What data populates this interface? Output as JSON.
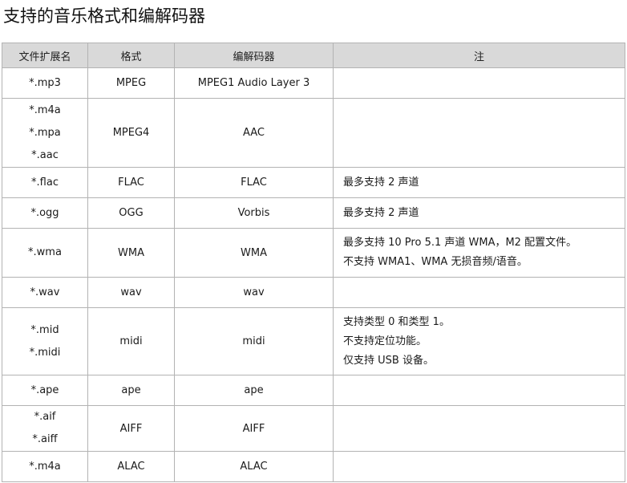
{
  "title": "支持的音乐格式和编解码器",
  "headers": [
    "文件扩展名",
    "格式",
    "编解码器",
    "注"
  ],
  "rows": [
    {
      "ext": [
        "*.mp3"
      ],
      "format": "MPEG",
      "codec": "MPEG1 Audio Layer 3",
      "notes": []
    },
    {
      "ext": [
        "*.m4a",
        "*.mpa",
        "*.aac"
      ],
      "format": "MPEG4",
      "codec": "AAC",
      "notes": []
    },
    {
      "ext": [
        "*.flac"
      ],
      "format": "FLAC",
      "codec": "FLAC",
      "notes": [
        "最多支持 2 声道"
      ]
    },
    {
      "ext": [
        "*.ogg"
      ],
      "format": "OGG",
      "codec": "Vorbis",
      "notes": [
        "最多支持 2 声道"
      ]
    },
    {
      "ext": [
        "*.wma"
      ],
      "format": "WMA",
      "codec": "WMA",
      "notes": [
        "最多支持 10 Pro 5.1 声道 WMA，M2 配置文件。",
        "不支持 WMA1、WMA 无损音频/语音。"
      ]
    },
    {
      "ext": [
        "*.wav"
      ],
      "format": "wav",
      "codec": "wav",
      "notes": []
    },
    {
      "ext": [
        "*.mid",
        "*.midi"
      ],
      "format": "midi",
      "codec": "midi",
      "notes": [
        "支持类型 0 和类型 1。",
        "不支持定位功能。",
        "仅支持 USB 设备。"
      ]
    },
    {
      "ext": [
        "*.ape"
      ],
      "format": "ape",
      "codec": "ape",
      "notes": []
    },
    {
      "ext": [
        "*.aif",
        "*.aiff"
      ],
      "format": "AIFF",
      "codec": "AIFF",
      "notes": []
    },
    {
      "ext": [
        "*.m4a"
      ],
      "format": "ALAC",
      "codec": "ALAC",
      "notes": []
    }
  ]
}
